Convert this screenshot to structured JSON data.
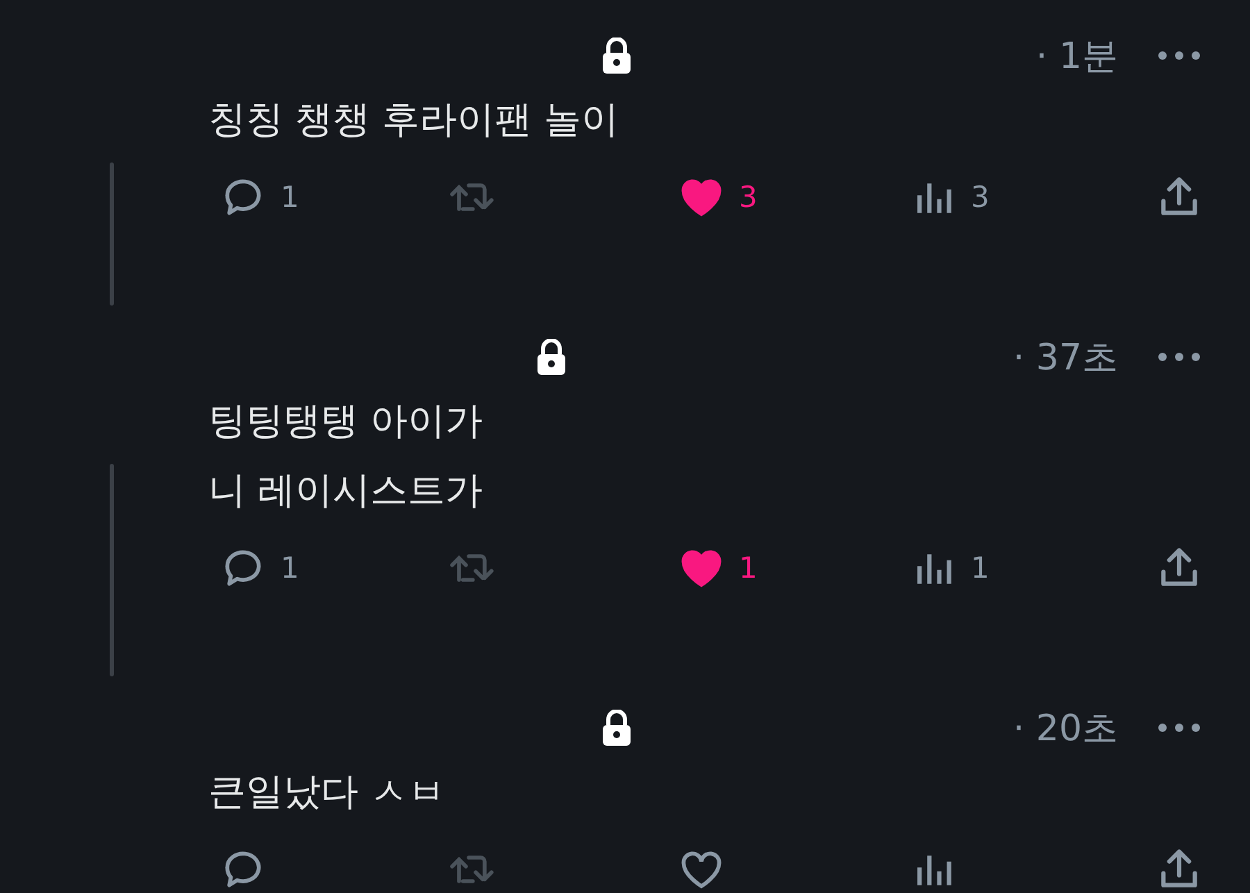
{
  "tweets": [
    {
      "protected": true,
      "time": "· 1분",
      "text": [
        "칭칭 챙챙 후라이팬 놀이"
      ],
      "thread_line": true,
      "replies": "1",
      "likes": "3",
      "liked": true,
      "views": "3"
    },
    {
      "protected": true,
      "time": "· 37초",
      "text": [
        "팅팅탱탱 아이가",
        "니 레이시스트가"
      ],
      "thread_line": true,
      "replies": "1",
      "likes": "1",
      "liked": true,
      "views": "1"
    },
    {
      "protected": true,
      "time": "· 20초",
      "text": [
        "큰일났다 ㅅㅂ"
      ],
      "thread_line": false,
      "liked": false
    }
  ]
}
